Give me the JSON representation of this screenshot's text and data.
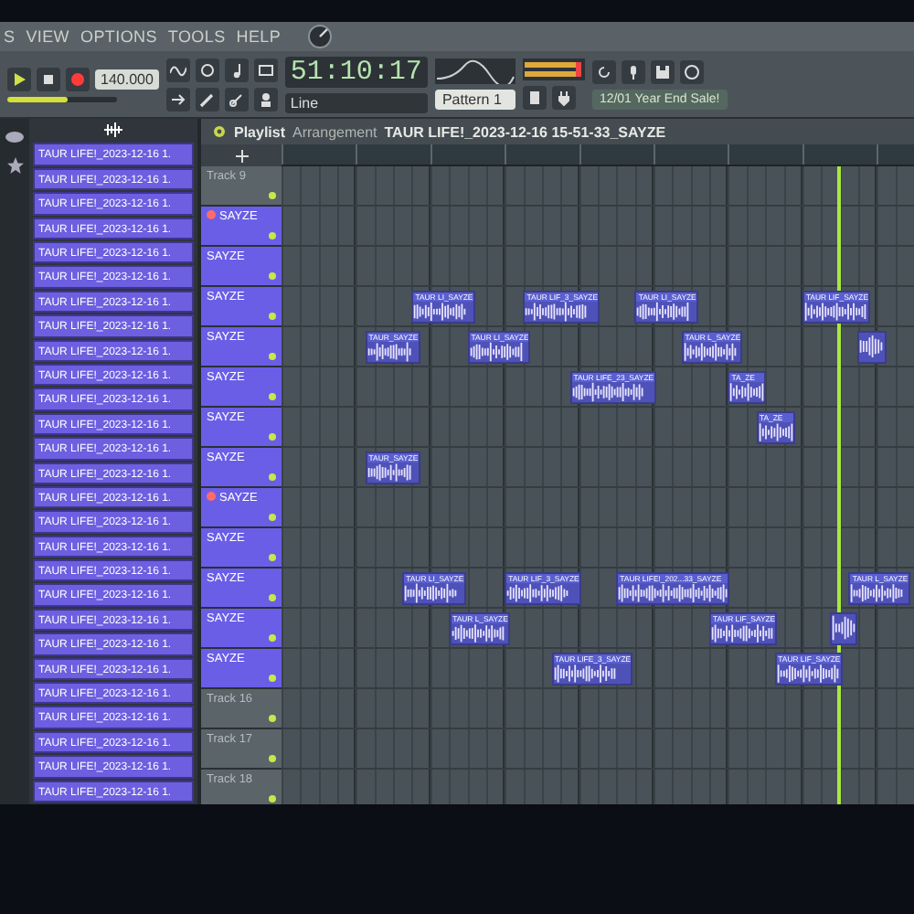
{
  "menu": [
    "S",
    "VIEW",
    "OPTIONS",
    "TOOLS",
    "HELP"
  ],
  "toolbar": {
    "tempo": "140.000",
    "time": "51:10:17",
    "master_slider": {
      "level": 0.55
    },
    "snap": "Line",
    "pattern": "Pattern 1",
    "hint": "12/01 Year End Sale!"
  },
  "browser": {
    "items": [
      "TAUR LIFE!_2023-12-16 1.",
      "TAUR LIFE!_2023-12-16 1.",
      "TAUR LIFE!_2023-12-16 1.",
      "TAUR LIFE!_2023-12-16 1.",
      "TAUR LIFE!_2023-12-16 1.",
      "TAUR LIFE!_2023-12-16 1.",
      "TAUR LIFE!_2023-12-16 1.",
      "TAUR LIFE!_2023-12-16 1.",
      "TAUR LIFE!_2023-12-16 1.",
      "TAUR LIFE!_2023-12-16 1.",
      "TAUR LIFE!_2023-12-16 1.",
      "TAUR LIFE!_2023-12-16 1.",
      "TAUR LIFE!_2023-12-16 1.",
      "TAUR LIFE!_2023-12-16 1.",
      "TAUR LIFE!_2023-12-16 1.",
      "TAUR LIFE!_2023-12-16 1.",
      "TAUR LIFE!_2023-12-16 1.",
      "TAUR LIFE!_2023-12-16 1.",
      "TAUR LIFE!_2023-12-16 1.",
      "TAUR LIFE!_2023-12-16 1.",
      "TAUR LIFE!_2023-12-16 1.",
      "TAUR LIFE!_2023-12-16 1.",
      "TAUR LIFE!_2023-12-16 1.",
      "TAUR LIFE!_2023-12-16 1.",
      "TAUR LIFE!_2023-12-16 1.",
      "TAUR LIFE!_2023-12-16 1.",
      "TAUR LIFE!_2023-12-16 1."
    ]
  },
  "playlist": {
    "title": "Playlist",
    "subtitle": "Arrangement",
    "arrangement_name": "TAUR LIFE!_2023-12-16 15-51-33_SAYZE",
    "playhead": {
      "level": 0.88
    },
    "tracks": [
      {
        "name": "Track 9",
        "kind": "lane",
        "selected": false
      },
      {
        "name": "SAYZE",
        "kind": "group_header",
        "selected": true
      },
      {
        "name": "SAYZE",
        "kind": "lane",
        "selected": true
      },
      {
        "name": "SAYZE",
        "kind": "lane",
        "selected": true,
        "clips": [
          {
            "label": "TAUR LI_SAYZE"
          },
          {
            "label": "TAUR LIF_3_SAYZE"
          },
          {
            "label": "TAUR LI_SAYZE"
          },
          {
            "label": "TAUR LIF_SAYZE"
          }
        ]
      },
      {
        "name": "SAYZE",
        "kind": "lane",
        "selected": true,
        "clips": [
          {
            "label": "TAUR_SAYZE"
          },
          {
            "label": "TAUR LI_SAYZE"
          },
          {
            "label": "TAUR L_SAYZE"
          },
          {
            "kind": "audio"
          }
        ]
      },
      {
        "name": "SAYZE",
        "kind": "lane",
        "selected": true,
        "clips": [
          {
            "label": "TAUR LIFE_23_SAYZE"
          },
          {
            "label": "TA_ZE"
          }
        ]
      },
      {
        "name": "SAYZE",
        "kind": "lane",
        "selected": true,
        "clips": [
          {
            "label": "TA_ZE"
          }
        ]
      },
      {
        "name": "SAYZE",
        "kind": "lane",
        "selected": true,
        "clips": [
          {
            "label": "TAUR_SAYZE"
          }
        ]
      },
      {
        "name": "SAYZE",
        "kind": "group_header",
        "selected": true
      },
      {
        "name": "SAYZE",
        "kind": "lane",
        "selected": true
      },
      {
        "name": "SAYZE",
        "kind": "lane",
        "selected": true,
        "clips": [
          {
            "label": "TAUR LI_SAYZE"
          },
          {
            "label": "TAUR LIF_3_SAYZE"
          },
          {
            "label": "TAUR LIFE!_202...33_SAYZE"
          },
          {
            "label": "TAUR L_SAYZE"
          }
        ]
      },
      {
        "name": "SAYZE",
        "kind": "lane",
        "selected": true,
        "clips": [
          {
            "label": "TAUR L_SAYZE"
          },
          {
            "label": "TAUR LIF_SAYZE"
          },
          {
            "kind": "audio"
          }
        ]
      },
      {
        "name": "SAYZE",
        "kind": "lane",
        "selected": true,
        "clips": [
          {
            "label": "TAUR LIFE_3_SAYZE"
          },
          {
            "label": "TAUR LIF_SAYZE"
          }
        ]
      },
      {
        "name": "Track 16",
        "kind": "lane",
        "selected": false
      },
      {
        "name": "Track 17",
        "kind": "lane",
        "selected": false
      },
      {
        "name": "Track 18",
        "kind": "lane",
        "selected": false
      }
    ]
  }
}
